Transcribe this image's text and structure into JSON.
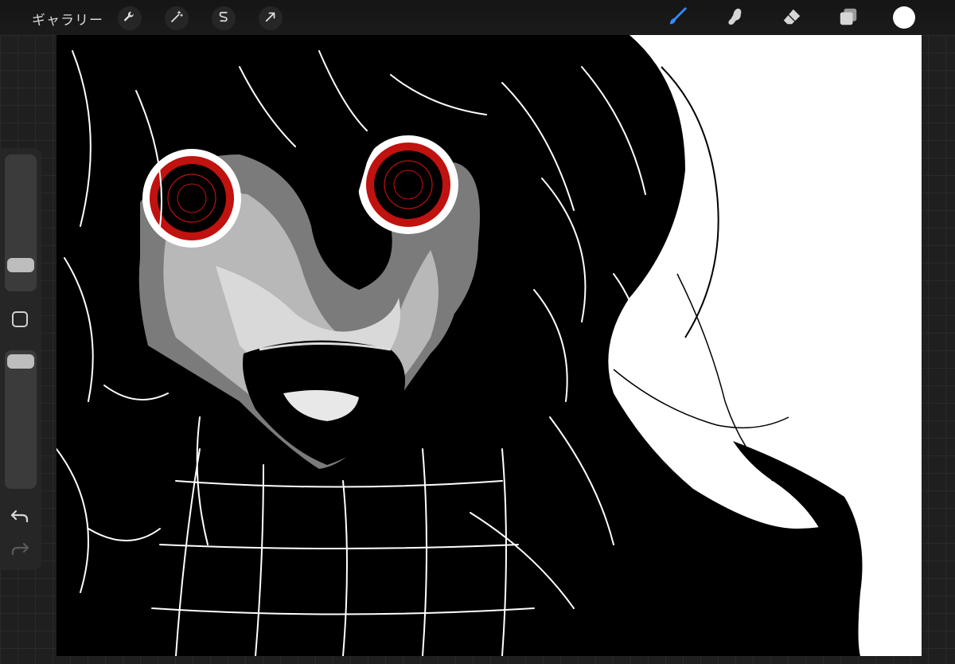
{
  "topbar": {
    "gallery_label": "ギャラリー",
    "left_tools": [
      {
        "name": "actions",
        "icon": "wrench-icon"
      },
      {
        "name": "adjustments",
        "icon": "magic-wand-icon"
      },
      {
        "name": "selection",
        "icon": "selection-s-icon"
      },
      {
        "name": "transform",
        "icon": "arrow-cursor-icon"
      }
    ],
    "right_tools": [
      {
        "name": "brush",
        "icon": "brush-icon",
        "active": true
      },
      {
        "name": "smudge",
        "icon": "smudge-icon",
        "active": false
      },
      {
        "name": "eraser",
        "icon": "eraser-icon",
        "active": false
      },
      {
        "name": "layers",
        "icon": "layers-icon",
        "active": false
      }
    ],
    "current_color": "#ffffff",
    "active_tool_color": "#2f8cff"
  },
  "sidebar": {
    "brush_size_level": 0.22,
    "opacity_level": 0.92,
    "modify_icon": "square-icon",
    "undo_icon": "undo-icon",
    "redo_icon": "redo-icon"
  },
  "artwork": {
    "accent_color": "#c0120f",
    "ink_color": "#000000",
    "paper_color": "#ffffff"
  }
}
